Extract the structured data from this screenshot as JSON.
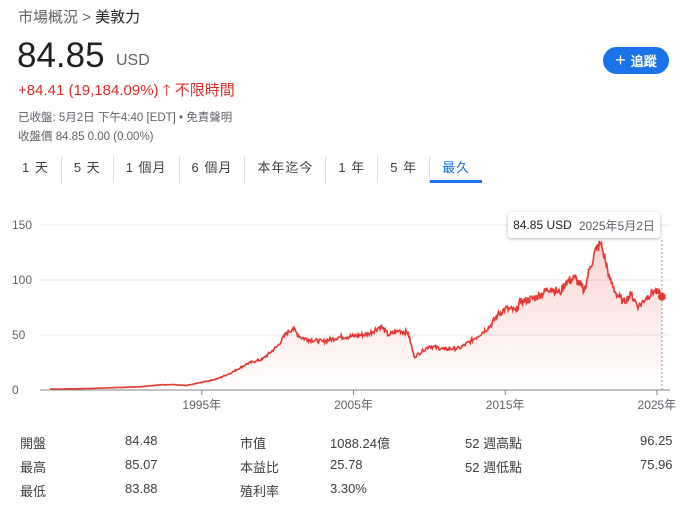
{
  "breadcrumb": {
    "root": "市場概況",
    "sep": ">",
    "current": "美敦力"
  },
  "price": "84.85",
  "currency": "USD",
  "change": "+84.41 (19,184.09%)",
  "change_icon": "arrow-up-icon",
  "period": "不限時間",
  "status": "已收盤: 5月2日 下午4:40 [EDT] • 免責聲明",
  "close": "收盤價 84.85 0.00 (0.00%)",
  "follow_label": "追蹤",
  "tabs": [
    "1 天",
    "5 天",
    "1 個月",
    "6 個月",
    "本年迄今",
    "1 年",
    "5 年",
    "最久"
  ],
  "active_tab": 7,
  "tooltip": {
    "price": "84.85 USD",
    "date": "2025年5月2日"
  },
  "colors": {
    "line": "#e53935",
    "accent": "#1a73e8",
    "negative": "#d93025"
  },
  "chart_data": {
    "type": "line",
    "yticks": [
      "0",
      "50",
      "100",
      "150"
    ],
    "ylim": [
      0,
      150
    ],
    "xticks": [
      {
        "x": 1995,
        "label": "1995年"
      },
      {
        "x": 2005,
        "label": "2005年"
      },
      {
        "x": 2015,
        "label": "2015年"
      },
      {
        "x": 2025,
        "label": "2025年"
      }
    ],
    "xlim": [
      1984.6,
      2025.6
    ],
    "points": [
      [
        1985,
        0.8
      ],
      [
        1987,
        1.2
      ],
      [
        1989,
        2
      ],
      [
        1991,
        3
      ],
      [
        1992,
        4.5
      ],
      [
        1993,
        5
      ],
      [
        1994,
        4
      ],
      [
        1995,
        7
      ],
      [
        1996,
        10
      ],
      [
        1997,
        16
      ],
      [
        1998,
        24
      ],
      [
        1999,
        28
      ],
      [
        2000,
        40
      ],
      [
        2000.6,
        52
      ],
      [
        2001,
        56
      ],
      [
        2001.5,
        48
      ],
      [
        2002,
        46
      ],
      [
        2003,
        44
      ],
      [
        2004,
        48
      ],
      [
        2005,
        49
      ],
      [
        2006,
        51
      ],
      [
        2006.8,
        58
      ],
      [
        2007.3,
        50
      ],
      [
        2008,
        54
      ],
      [
        2008.6,
        52
      ],
      [
        2009,
        30
      ],
      [
        2009.6,
        36
      ],
      [
        2010,
        40
      ],
      [
        2011,
        37
      ],
      [
        2012,
        38
      ],
      [
        2013,
        47
      ],
      [
        2014,
        58
      ],
      [
        2014.5,
        68
      ],
      [
        2015,
        74
      ],
      [
        2015.7,
        72
      ],
      [
        2016,
        80
      ],
      [
        2017,
        84
      ],
      [
        2018,
        93
      ],
      [
        2018.6,
        88
      ],
      [
        2019,
        98
      ],
      [
        2019.6,
        102
      ],
      [
        2020.2,
        90
      ],
      [
        2020.6,
        112
      ],
      [
        2021,
        128
      ],
      [
        2021.3,
        133
      ],
      [
        2021.6,
        118
      ],
      [
        2021.9,
        100
      ],
      [
        2022.3,
        88
      ],
      [
        2022.8,
        80
      ],
      [
        2023.3,
        87
      ],
      [
        2023.8,
        76
      ],
      [
        2024.3,
        84
      ],
      [
        2024.8,
        90
      ],
      [
        2025.1,
        88
      ],
      [
        2025.33,
        84.85
      ]
    ]
  },
  "stats": [
    {
      "label": "開盤",
      "value": "84.48"
    },
    {
      "label": "最高",
      "value": "85.07"
    },
    {
      "label": "最低",
      "value": "83.88"
    },
    {
      "label": "市值",
      "value": "1088.24億"
    },
    {
      "label": "本益比",
      "value": "25.78"
    },
    {
      "label": "殖利率",
      "value": "3.30%"
    },
    {
      "label": "52 週高點",
      "value": "96.25"
    },
    {
      "label": "52 週低點",
      "value": "75.96"
    }
  ]
}
